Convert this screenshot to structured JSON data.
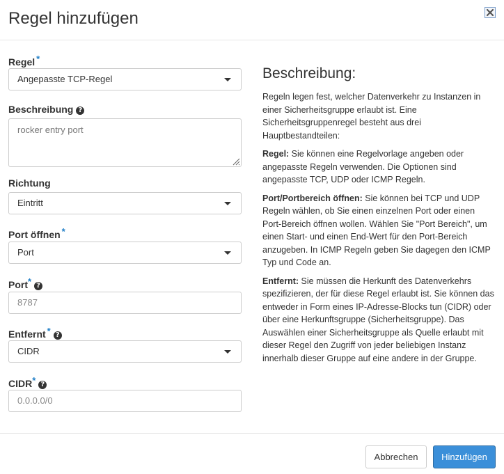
{
  "dialog": {
    "title": "Regel hinzufügen",
    "close_icon": "close-x-icon"
  },
  "form": {
    "rule": {
      "label": "Regel",
      "required_mark": "*",
      "value": "Angepasste TCP-Regel"
    },
    "description": {
      "label": "Beschreibung",
      "help_icon": "question-circle-icon",
      "help_glyph": "?",
      "value": "rocker entry port"
    },
    "direction": {
      "label": "Richtung",
      "value": "Eintritt"
    },
    "open_port": {
      "label": "Port öffnen",
      "required_mark": "*",
      "value": "Port"
    },
    "port": {
      "label": "Port",
      "required_mark": "*",
      "help_glyph": "?",
      "placeholder": "8787"
    },
    "remote": {
      "label": "Entfernt",
      "required_mark": "*",
      "help_glyph": "?",
      "value": "CIDR"
    },
    "cidr": {
      "label": "CIDR",
      "required_mark": "*",
      "help_glyph": "?",
      "placeholder": "0.0.0.0/0"
    }
  },
  "help_panel": {
    "title": "Beschreibung:",
    "intro": "Regeln legen fest, welcher Datenverkehr zu Instanzen in einer Sicherheitsgruppe erlaubt ist. Eine Sicherheitsgruppenregel besteht aus drei Hauptbestandteilen:",
    "rule_term": "Regel:",
    "rule_text": " Sie können eine Regelvorlage angeben oder angepasste Regeln verwenden. Die Optionen sind angepasste TCP, UDP oder ICMP Regeln.",
    "port_term": "Port/Portbereich öffnen:",
    "port_text": " Sie können bei TCP und UDP Regeln wählen, ob Sie einen einzelnen Port oder einen Port-Bereich öffnen wollen. Wählen Sie \"Port Bereich\", um einen Start- und einen End-Wert für den Port-Bereich anzugeben. In ICMP Regeln geben Sie dagegen den ICMP Typ und Code an.",
    "remote_term": "Entfernt:",
    "remote_text": " Sie müssen die Herkunft des Datenverkehrs spezifizieren, der für diese Regel erlaubt ist. Sie können das entweder in Form eines IP-Adresse-Blocks tun (CIDR) oder über eine Herkunftsgruppe (Sicherheitsgruppe). Das Auswählen einer Sicherheitsgruppe als Quelle erlaubt mit dieser Regel den Zugriff von jeder beliebigen Instanz innerhalb dieser Gruppe auf eine andere in der Gruppe."
  },
  "footer": {
    "cancel_label": "Abbrechen",
    "submit_label": "Hinzufügen"
  },
  "colors": {
    "primary": "#3b8fd9",
    "required": "#1f7ec7"
  }
}
